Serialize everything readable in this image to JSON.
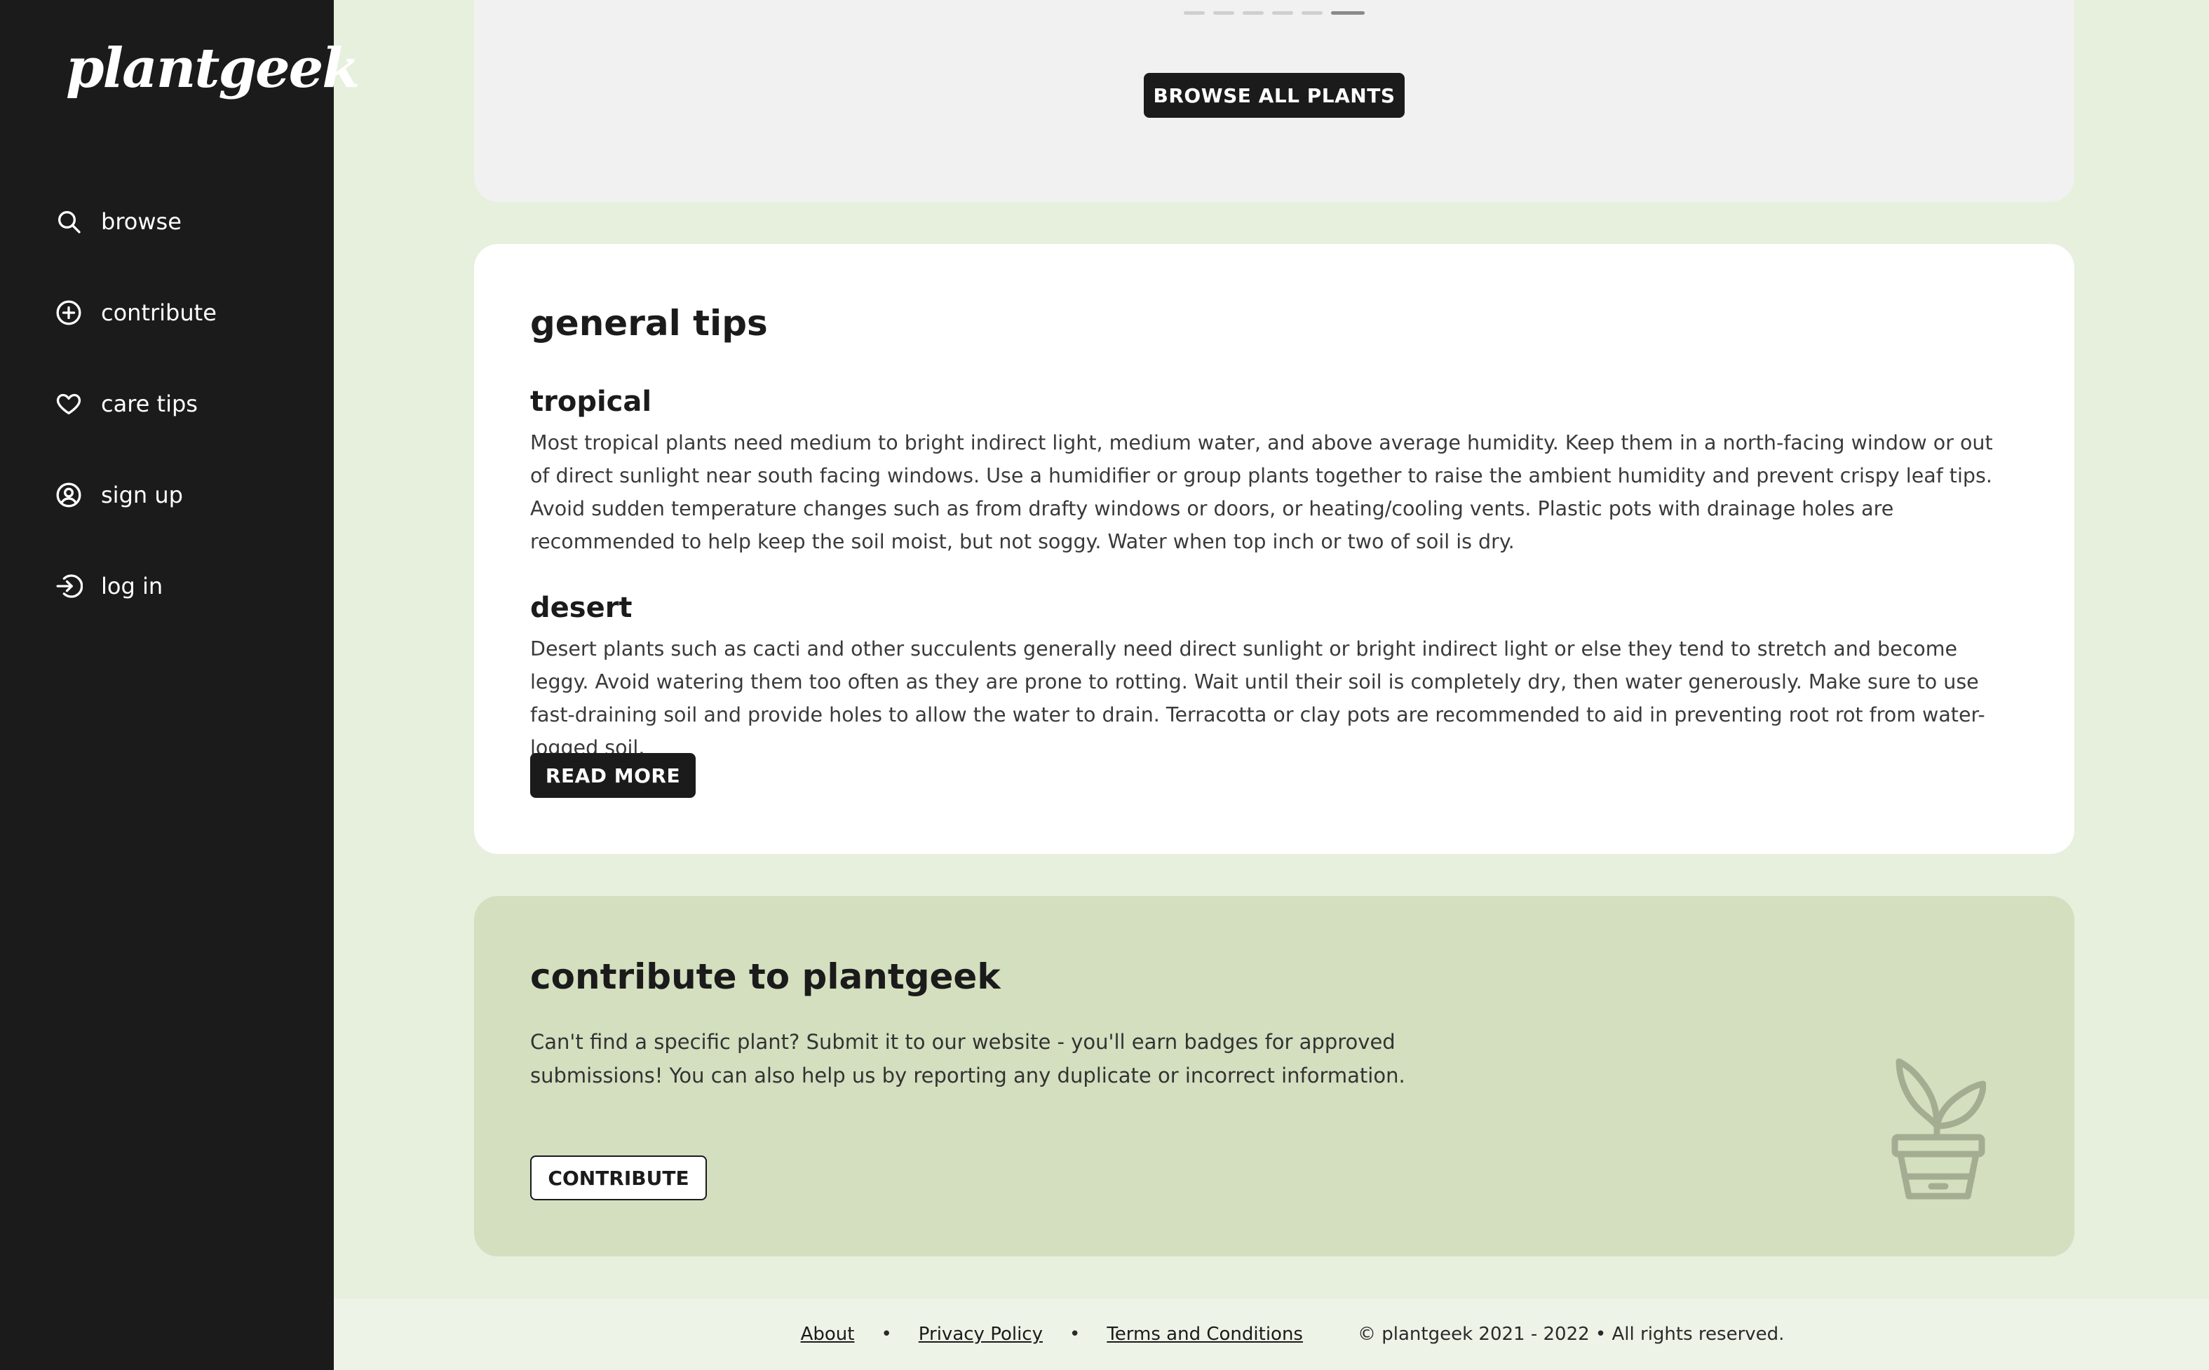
{
  "brand": {
    "name": "plantgeek"
  },
  "sidebar": {
    "items": [
      {
        "label": "browse",
        "icon": "search-icon"
      },
      {
        "label": "contribute",
        "icon": "plus-circle-icon"
      },
      {
        "label": "care tips",
        "icon": "heart-icon"
      },
      {
        "label": "sign up",
        "icon": "user-circle-icon"
      },
      {
        "label": "log in",
        "icon": "login-icon"
      }
    ]
  },
  "browse_card": {
    "button_label": "BROWSE ALL PLANTS",
    "carousel_pages": 6,
    "carousel_active_page": 6
  },
  "tips_card": {
    "title": "general tips",
    "sections": [
      {
        "heading": "tropical",
        "text": "Most tropical plants need medium to bright indirect light, medium water, and above average humidity. Keep them in a north-facing window or out of direct sunlight near south facing windows. Use a humidifier or group plants together to raise the ambient humidity and prevent crispy leaf tips. Avoid sudden temperature changes such as from drafty windows or doors, or heating/cooling vents. Plastic pots with drainage holes are recommended to help keep the soil moist, but not soggy. Water when top inch or two of soil is dry."
      },
      {
        "heading": "desert",
        "text": "Desert plants such as cacti and other succulents generally need direct sunlight or bright indirect light or else they tend to stretch and become leggy. Avoid watering them too often as they are prone to rotting. Wait until their soil is completely dry, then water generously. Make sure to use fast-draining soil and provide holes to allow the water to drain. Terracotta or clay pots are recommended to aid in preventing root rot from water-logged soil."
      }
    ],
    "button_label": "READ MORE"
  },
  "contribute_card": {
    "title": "contribute to plantgeek",
    "text": "Can't find a specific plant? Submit it to our website - you'll earn badges for approved submissions! You can also help us by reporting any duplicate or incorrect information.",
    "button_label": "CONTRIBUTE",
    "icon": "potted-plant-icon"
  },
  "footer": {
    "links": [
      "About",
      "Privacy Policy",
      "Terms and Conditions"
    ],
    "separator": "•",
    "copyright": "© plantgeek 2021 - 2022 • All rights reserved."
  },
  "colors": {
    "sidebar_bg": "#1b1b1b",
    "page_bg": "#e7efdd",
    "contribute_bg": "#d3dfbf",
    "browse_card_bg": "#f1f1f1"
  }
}
